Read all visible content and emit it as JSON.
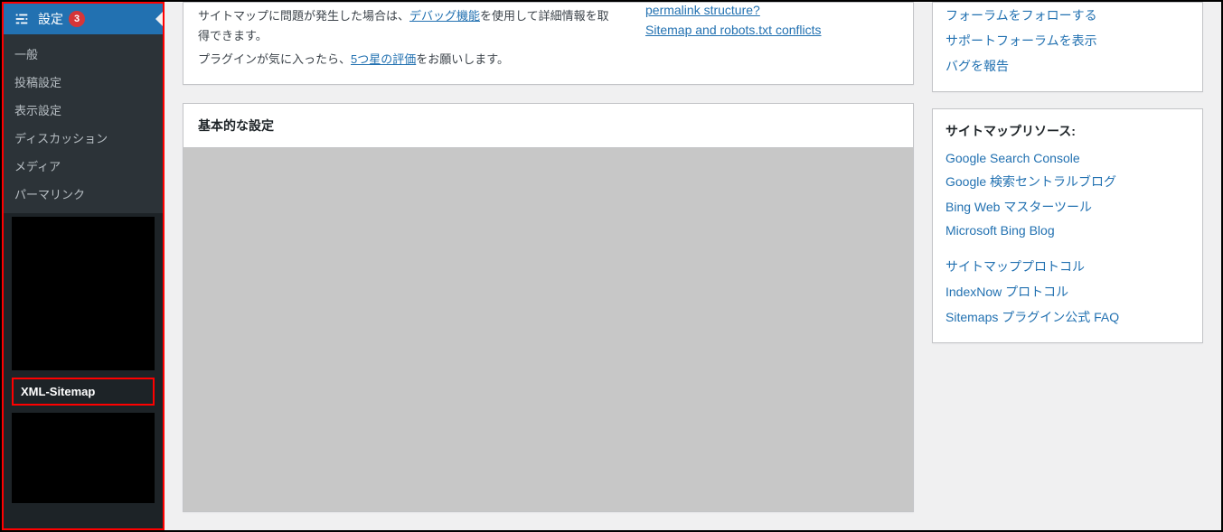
{
  "sidebar": {
    "header_label": "設定",
    "badge_count": "3",
    "items": [
      "一般",
      "投稿設定",
      "表示設定",
      "ディスカッション",
      "メディア",
      "パーマリンク"
    ],
    "xml_sitemap_label": "XML-Sitemap"
  },
  "top_panel": {
    "para1_prefix": "サイトマップに問題が発生した場合は、",
    "para1_link": "デバッグ機能",
    "para1_suffix": "を使用して詳細情報を取得できます。",
    "para2_prefix": "プラグインが気に入ったら、",
    "para2_link": "5つ星の評価",
    "para2_suffix": "をお願いします。",
    "right_links": [
      "permalink structure?",
      "Sitemap and robots.txt conflicts"
    ]
  },
  "settings_panel": {
    "title": "基本的な設定"
  },
  "right_panels": {
    "support_links": [
      "フォーラムをフォローする",
      "サポートフォーラムを表示",
      "バグを報告"
    ],
    "resources_title": "サイトマップリソース:",
    "resources_group1": [
      "Google Search Console",
      "Google 検索セントラルブログ",
      "Bing Web マスターツール",
      "Microsoft Bing Blog"
    ],
    "resources_group2": [
      "サイトマッププロトコル",
      "IndexNow プロトコル",
      "Sitemaps プラグイン公式 FAQ"
    ]
  }
}
